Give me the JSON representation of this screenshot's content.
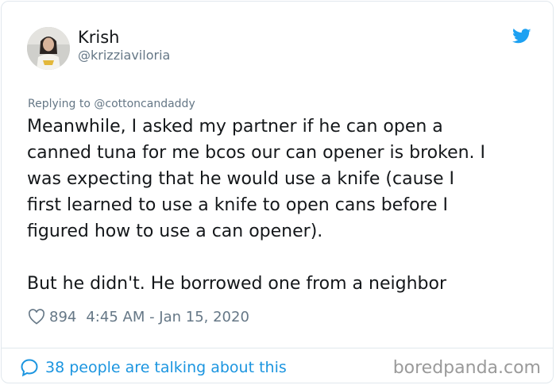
{
  "user": {
    "display_name": "Krish",
    "handle": "@krizziaviloria"
  },
  "reply": {
    "text": "Replying to @cottoncandaddy"
  },
  "tweet": {
    "paragraph1": "Meanwhile, I asked my partner if he can open a\ncanned tuna for me bcos our can opener is broken. I\nwas expecting that he would use a knife (cause I\nfirst learned to use a knife to open cans before I\nfigured how to use a can opener).",
    "paragraph2": "But he didn't. He borrowed one from a neighbor"
  },
  "meta": {
    "likes": "894",
    "timestamp": "4:45 AM - Jan 15, 2020"
  },
  "footer": {
    "talking": "38 people are talking about this",
    "watermark": "boredpanda.com"
  },
  "icons": {
    "brand": "twitter-bird-icon",
    "like": "heart-icon",
    "comment": "speech-bubble-icon"
  },
  "colors": {
    "twitter_blue": "#1da1f2",
    "link_blue": "#1b95e0",
    "secondary_text": "#657786",
    "primary_text": "#14171a",
    "border": "#e1e8ed"
  }
}
